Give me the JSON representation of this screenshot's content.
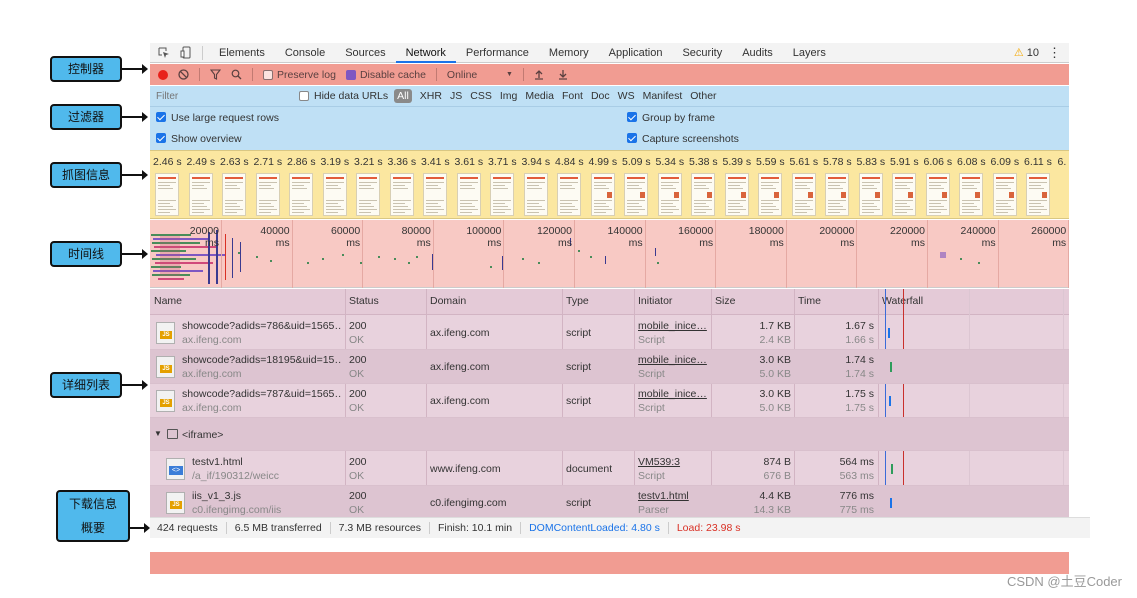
{
  "tabbar": {
    "tabs": [
      "Elements",
      "Console",
      "Sources",
      "Network",
      "Performance",
      "Memory",
      "Application",
      "Security",
      "Audits",
      "Layers"
    ],
    "active_tab": "Network",
    "warning_count": "10"
  },
  "controls": {
    "preserve_log": "Preserve log",
    "disable_cache": "Disable cache",
    "throttle": "Online",
    "throttle_caret": "▼"
  },
  "filter": {
    "placeholder": "Filter",
    "hide_data_urls": "Hide data URLs",
    "types": [
      "All",
      "XHR",
      "JS",
      "CSS",
      "Img",
      "Media",
      "Font",
      "Doc",
      "WS",
      "Manifest",
      "Other"
    ],
    "use_large_rows": "Use large request rows",
    "group_by_frame": "Group by frame",
    "show_overview": "Show overview",
    "capture_screenshots": "Capture screenshots"
  },
  "screenshots": {
    "times": [
      "2.46 s",
      "2.49 s",
      "2.63 s",
      "2.71 s",
      "2.86 s",
      "3.19 s",
      "3.21 s",
      "3.36 s",
      "3.41 s",
      "3.61 s",
      "3.71 s",
      "3.94 s",
      "4.84 s",
      "4.99 s",
      "5.09 s",
      "5.34 s",
      "5.38 s",
      "5.39 s",
      "5.59 s",
      "5.61 s",
      "5.78 s",
      "5.83 s",
      "5.91 s",
      "6.06 s",
      "6.08 s",
      "6.09 s",
      "6.11 s",
      "6."
    ]
  },
  "timeline": {
    "labels": [
      "20000 ms",
      "40000 ms",
      "60000 ms",
      "80000 ms",
      "100000 ms",
      "120000 ms",
      "140000 ms",
      "160000 ms",
      "180000 ms",
      "200000 ms",
      "220000 ms",
      "240000 ms",
      "260000 ms"
    ]
  },
  "table": {
    "headers": {
      "name": "Name",
      "status": "Status",
      "domain": "Domain",
      "type": "Type",
      "initiator": "Initiator",
      "size": "Size",
      "time": "Time",
      "waterfall": "Waterfall"
    },
    "rows": [
      {
        "name": "showcode?adids=786&uid=1565…",
        "domain_sub": "ax.ifeng.com",
        "status": "200",
        "status_text": "OK",
        "domain": "ax.ifeng.com",
        "type": "script",
        "initiator": "mobile_inice…",
        "initiator_sub": "Script",
        "size": "1.7 KB",
        "size_sub": "2.4 KB",
        "time": "1.67 s",
        "time_sub": "1.66 s"
      },
      {
        "name": "showcode?adids=18195&uid=15…",
        "domain_sub": "ax.ifeng.com",
        "status": "200",
        "status_text": "OK",
        "domain": "ax.ifeng.com",
        "type": "script",
        "initiator": "mobile_inice…",
        "initiator_sub": "Script",
        "size": "3.0 KB",
        "size_sub": "5.0 KB",
        "time": "1.74 s",
        "time_sub": "1.74 s"
      },
      {
        "name": "showcode?adids=787&uid=1565…",
        "domain_sub": "ax.ifeng.com",
        "status": "200",
        "status_text": "OK",
        "domain": "ax.ifeng.com",
        "type": "script",
        "initiator": "mobile_inice…",
        "initiator_sub": "Script",
        "size": "3.0 KB",
        "size_sub": "5.0 KB",
        "time": "1.75 s",
        "time_sub": "1.75 s"
      }
    ],
    "group": {
      "caret": "▼",
      "label": "<iframe>"
    },
    "group_rows": [
      {
        "name": "testv1.html",
        "domain_sub": "/a_if/190312/weicc",
        "status": "200",
        "status_text": "OK",
        "domain": "www.ifeng.com",
        "type": "document",
        "initiator": "VM539:3",
        "initiator_sub": "Script",
        "size": "874 B",
        "size_sub": "676 B",
        "time": "564 ms",
        "time_sub": "563 ms"
      },
      {
        "name": "iis_v1_3.js",
        "domain_sub": "c0.ifengimg.com/iis",
        "status": "200",
        "status_text": "OK",
        "domain": "c0.ifengimg.com",
        "type": "script",
        "initiator": "testv1.html",
        "initiator_sub": "Parser",
        "size": "4.4 KB",
        "size_sub": "14.3 KB",
        "time": "776 ms",
        "time_sub": "775 ms"
      }
    ]
  },
  "status": {
    "requests": "424 requests",
    "transferred": "6.5 MB transferred",
    "resources": "7.3 MB resources",
    "finish": "Finish: 10.1 min",
    "dom_content_loaded": "DOMContentLoaded: 4.80 s",
    "load": "Load: 23.98 s"
  },
  "callouts": {
    "controls": "控制器",
    "filters": "过滤器",
    "screenshots": "抓图信息",
    "timeline": "时间线",
    "details": "详细列表",
    "summary_line1": "下载信息",
    "summary_line2": "概要"
  },
  "watermark": "CSDN @土豆Coder",
  "colors": {
    "control_bar": "#f19c92",
    "filter_bar": "#bfe0f5",
    "screenshot_strip": "#fbe7a0",
    "timeline": "#f8c9c4",
    "table": "#e8d2dd",
    "callout": "#50b9ec"
  }
}
